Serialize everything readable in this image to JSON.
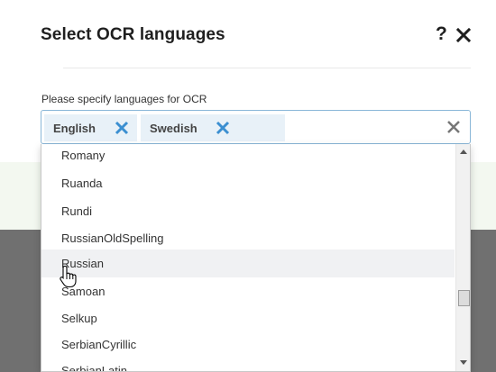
{
  "dialog": {
    "title": "Select OCR languages",
    "help_label": "?",
    "close_icon": "close-icon"
  },
  "field": {
    "label": "Please specify languages for OCR",
    "selected": [
      {
        "label": "English"
      },
      {
        "label": "Swedish"
      }
    ],
    "remove_icon": "x-icon",
    "clear_icon": "clear-all-icon"
  },
  "dropdown": {
    "options": [
      {
        "label": "Romany"
      },
      {
        "label": "Ruanda"
      },
      {
        "label": "Rundi"
      },
      {
        "label": "RussianOldSpelling"
      },
      {
        "label": "Russian"
      },
      {
        "label": "Samoan"
      },
      {
        "label": "Selkup"
      },
      {
        "label": "SerbianCyrillic"
      },
      {
        "label": "SerbianLatin"
      }
    ],
    "hovered": "Russian"
  },
  "colors": {
    "tag_remove": "#3b8fd1",
    "clear_all": "#777777",
    "tag_bg": "#e8f1f8",
    "field_border": "#8ab7d8"
  }
}
